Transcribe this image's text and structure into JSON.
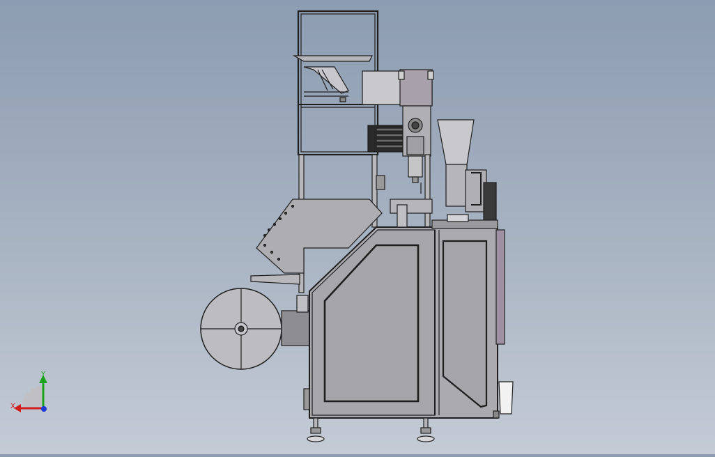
{
  "viewport": {
    "background_top": "#8c9cb1",
    "background_bottom": "#c4cbd5",
    "body_color": "#a9a9ad",
    "line_color": "#1e1e1e"
  },
  "triad": {
    "x_label": "X",
    "y_label": "Y",
    "x_color": "#d11a1a",
    "y_color": "#1aa51a",
    "z_color": "#1a3ad1"
  }
}
